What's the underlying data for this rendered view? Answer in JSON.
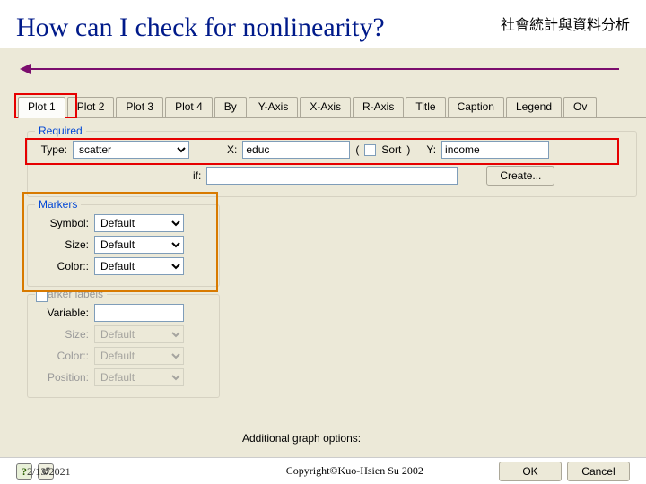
{
  "header": {
    "title": "How can I check for nonlinearity?",
    "subtitle": "社會統計與資料分析"
  },
  "tabs": [
    "Plot 1",
    "Plot 2",
    "Plot 3",
    "Plot 4",
    "By",
    "Y-Axis",
    "X-Axis",
    "R-Axis",
    "Title",
    "Caption",
    "Legend",
    "Ov"
  ],
  "required": {
    "legend": "Required",
    "type_label": "Type:",
    "type_value": "scatter",
    "x_label": "X:",
    "x_value": "educ",
    "sort_label": "Sort",
    "y_label": "Y:",
    "y_value": "income",
    "if_label": "if:",
    "if_value": "",
    "create_label": "Create..."
  },
  "markers": {
    "legend": "Markers",
    "symbol_label": "Symbol:",
    "symbol_value": "Default",
    "size_label": "Size:",
    "size_value": "Default",
    "color_label": "Color::",
    "color_value": "Default"
  },
  "markerlabels": {
    "legend": "Marker labels",
    "variable_label": "Variable:",
    "variable_value": "",
    "size_label": "Size:",
    "size_value": "Default",
    "color_label": "Color::",
    "color_value": "Default",
    "position_label": "Position:",
    "position_value": "Default"
  },
  "addl_label": "Additional graph options:",
  "footer": {
    "date": "2/13/2021",
    "copyright": "Copyright©Kuo-Hsien Su 2002",
    "ok": "OK",
    "cancel": "Cancel"
  }
}
